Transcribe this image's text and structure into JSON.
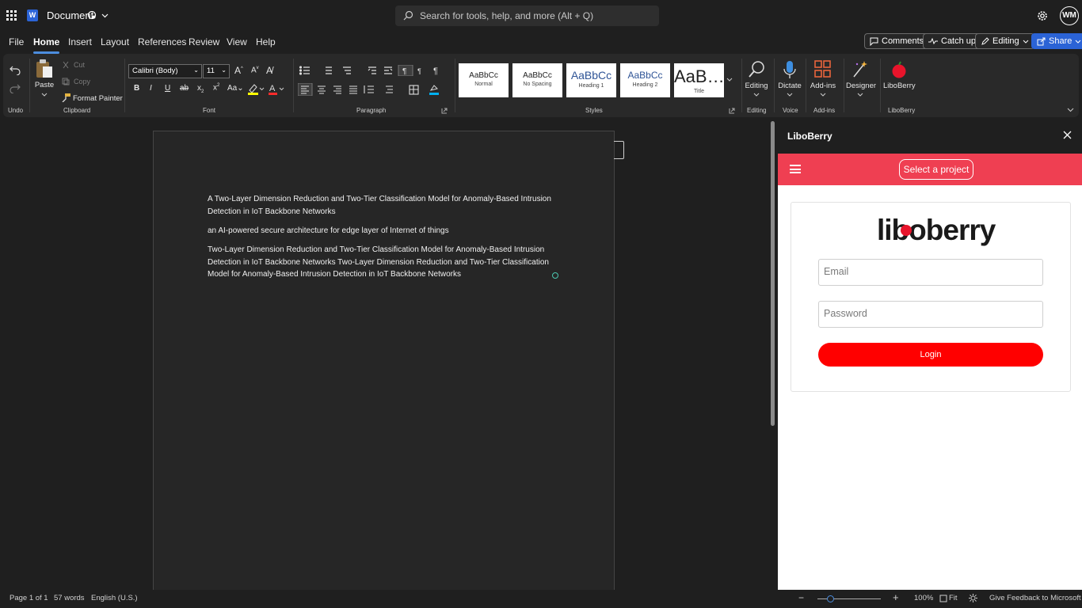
{
  "title_bar": {
    "app_icon": "word-icon",
    "app_letter": "W",
    "doc_title": "Document",
    "search_placeholder": "Search for tools, help, and more (Alt + Q)",
    "avatar_initials": "WM"
  },
  "menu": {
    "tabs": [
      "File",
      "Home",
      "Insert",
      "Layout",
      "References",
      "Review",
      "View",
      "Help"
    ],
    "active": "Home",
    "comments_label": "Comments",
    "catchup_label": "Catch up",
    "editing_label": "Editing",
    "share_label": "Share"
  },
  "ribbon": {
    "undo_label": "Undo",
    "clipboard": {
      "paste": "Paste",
      "cut": "Cut",
      "copy": "Copy",
      "format_painter": "Format Painter",
      "group": "Clipboard"
    },
    "font": {
      "family": "Calibri (Body)",
      "size": "11",
      "group": "Font"
    },
    "paragraph": {
      "group": "Paragraph"
    },
    "styles": {
      "items": [
        {
          "sample": "AaBbCc",
          "name": "Normal"
        },
        {
          "sample": "AaBbCc",
          "name": "No Spacing"
        },
        {
          "sample": "AaBbCc",
          "name": "Heading 1"
        },
        {
          "sample": "AaBbCc",
          "name": "Heading 2"
        },
        {
          "sample": "AaB…",
          "name": "Title"
        }
      ],
      "group": "Styles"
    },
    "editing": {
      "label": "Editing",
      "group": "Editing"
    },
    "voice": {
      "label": "Dictate",
      "group": "Voice"
    },
    "addins": {
      "label": "Add-ins",
      "group": "Add-ins"
    },
    "designer": {
      "label": "Designer"
    },
    "liboberry": {
      "label": "LiboBerry",
      "group": "LiboBerry"
    }
  },
  "document": {
    "paragraphs": [
      "A Two-Layer Dimension Reduction and Two-Tier Classification Model for Anomaly-Based Intrusion Detection in IoT Backbone Networks",
      "an AI-powered secure architecture for edge layer of Internet of things",
      "Two-Layer Dimension Reduction and Two-Tier Classification Model for Anomaly-Based Intrusion Detection in IoT Backbone Networks Two-Layer Dimension Reduction and Two-Tier Classification Model for Anomaly-Based Intrusion Detection in IoT Backbone Networks"
    ]
  },
  "pane": {
    "title": "LiboBerry",
    "select_project": "Select a project",
    "logo_text": "liboberry",
    "email_placeholder": "Email",
    "password_placeholder": "Password",
    "login_label": "Login"
  },
  "status": {
    "page": "Page 1 of 1",
    "words": "57 words",
    "language": "English (U.S.)",
    "zoom": "100%",
    "zoom_percent": 100,
    "fit": "Fit",
    "feedback": "Give Feedback to Microsoft"
  },
  "colors": {
    "accent": "#4c8dde",
    "share": "#2b63d6",
    "pane_bar": "#ef3f52",
    "login": "#ff0000"
  }
}
